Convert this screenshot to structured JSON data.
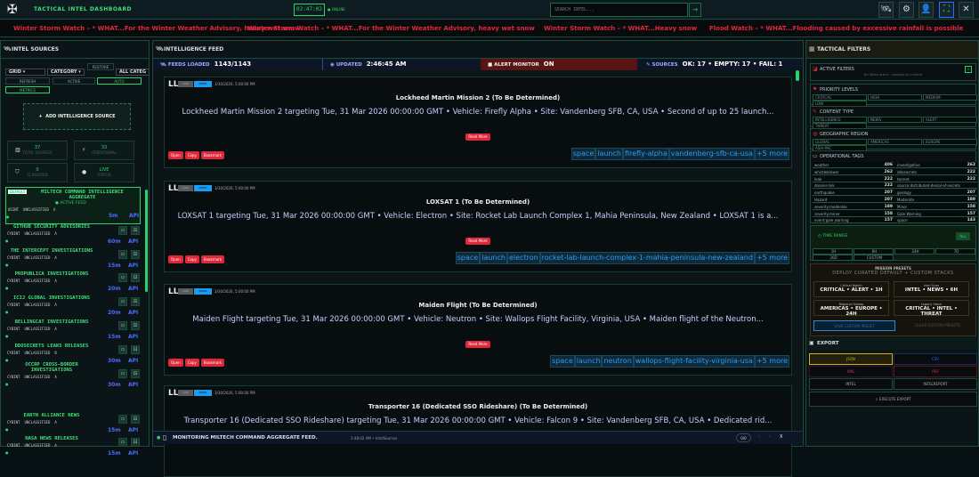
{
  "header": {
    "title": "TACTICAL INTEL DASHBOARD",
    "clock": "02:47:02",
    "status": "ONLINE",
    "search_placeholder": "SEARCH INTEL...",
    "search_go": "→",
    "icons": [
      "satellite-icon",
      "gear-icon",
      "user-icon",
      "fullscreen-icon",
      "close-icon"
    ]
  },
  "ticker": [
    "Winter Storm Watch – * WHAT...For the Winter Weather Advisory, heavy wet snow",
    "Winter Storm Watch – * WHAT...For the Winter Weather Advisory, heavy wet snow",
    "Winter Storm Watch – * WHAT...Heavy snow",
    "Flood Watch – * WHAT...Flooding caused by excessive rainfall is possible"
  ],
  "left": {
    "title": "INTEL SOURCES",
    "view": "GRID",
    "sort": "CATEGORY",
    "filter": "ALL CATEG",
    "restore": "RESTORE",
    "refresh": "REFRESH",
    "active": "ACTIVE",
    "auto": "AUTO",
    "metrics": "METRICS",
    "add": "ADD INTELLIGENCE SOURCE",
    "stats": [
      {
        "v": "37",
        "l": "TOTAL SOURCES",
        "i": "▥"
      },
      {
        "v": "33",
        "l": "OPERATIONAL",
        "i": "⚡"
      },
      {
        "v": "0",
        "l": "CLASSIFIED",
        "i": "⛉"
      },
      {
        "v": "LIVE",
        "l": "STATUS",
        "i": "●"
      }
    ],
    "default_badge": "DEFAULT",
    "active_feed": "● ACTIVE FEED",
    "sources": [
      {
        "name": "MILTECH COMMAND INTELLIGENCE AGGREGATE",
        "type": "OSINT",
        "cls": "UNCLASSIFIED",
        "grade": "A",
        "interval": "5m",
        "api": "API"
      },
      {
        "name": "GITHUB SECURITY ADVISORIES",
        "type": "CYBINT",
        "cls": "UNCLASSIFIED",
        "grade": "A",
        "interval": "60m",
        "api": "API"
      },
      {
        "name": "THE INTERCEPT INVESTIGATIONS",
        "type": "CYBINT",
        "cls": "UNCLASSIFIED",
        "grade": "A",
        "interval": "15m",
        "api": "API"
      },
      {
        "name": "PROPUBLICA INVESTIGATIONS",
        "type": "CYBINT",
        "cls": "UNCLASSIFIED",
        "grade": "A",
        "interval": "20m",
        "api": "API"
      },
      {
        "name": "ICIJ GLOBAL INVESTIGATIONS",
        "type": "CYBINT",
        "cls": "UNCLASSIFIED",
        "grade": "A",
        "interval": "20m",
        "api": "API"
      },
      {
        "name": "BELLINGCAT INVESTIGATIONS",
        "type": "CYBINT",
        "cls": "UNCLASSIFIED",
        "grade": "A",
        "interval": "15m",
        "api": "API"
      },
      {
        "name": "DDOSECRETS LEAKS RELEASES",
        "type": "CYBINT",
        "cls": "UNCLASSIFIED",
        "grade": "B",
        "interval": "30m",
        "api": "API"
      },
      {
        "name": "OCCRP CROSS-BORDER INVESTIGATIONS",
        "type": "CYBINT",
        "cls": "UNCLASSIFIED",
        "grade": "A",
        "interval": "30m",
        "api": "API"
      },
      {
        "name": "EARTH ALLIANCE NEWS",
        "type": "CYBINT",
        "cls": "UNCLASSIFIED",
        "grade": "A",
        "interval": "15m",
        "api": "API"
      },
      {
        "name": "NASA NEWS RELEASES",
        "type": "CYBINT",
        "cls": "UNCLASSIFIED",
        "grade": "A",
        "interval": "15m",
        "api": "API"
      }
    ]
  },
  "feed": {
    "title": "INTELLIGENCE FEED",
    "loaded_label": "FEEDS LOADED",
    "loaded": "1143/1143",
    "updated_label": "UPDATED",
    "updated": "2:46:45 AM",
    "alert_label": "ALERT MONITOR",
    "alert": "ON",
    "sources_label": "SOURCES",
    "sources": "OK: 17 • EMPTY: 17 • FAIL: 1",
    "source_abbr": "LL",
    "badge1": "LOW",
    "badge2": "NEWS",
    "read_more": "Read More",
    "actions": [
      "Open",
      "Copy",
      "Bookmark"
    ],
    "items": [
      {
        "date": "3/30/2026, 5:00:00 PM",
        "title": "Lockheed Martin Mission 2 (To Be Determined)",
        "summary": "Lockheed Martin Mission 2 targeting Tue, 31 Mar 2026 00:00:00 GMT • Vehicle: Firefly Alpha • Site: Vandenberg SFB, CA, USA • Second of up to 25 launch...",
        "tags": [
          "space",
          "launch",
          "firefly-alpha",
          "vandenberg-sfb-ca-usa",
          "+5 more"
        ]
      },
      {
        "date": "3/30/2026, 5:00:00 PM",
        "title": "LOXSAT 1 (To Be Determined)",
        "summary": "LOXSAT 1 targeting Tue, 31 Mar 2026 00:00:00 GMT • Vehicle: Electron • Site: Rocket Lab Launch Complex 1, Mahia Peninsula, New Zealand • LOXSAT 1 is a...",
        "tags": [
          "space",
          "launch",
          "electron",
          "rocket-lab-launch-complex-1-mahia-peninsula-new-zealand",
          "+5 more"
        ]
      },
      {
        "date": "3/30/2026, 5:00:00 PM",
        "title": "Maiden Flight (To Be Determined)",
        "summary": "Maiden Flight targeting Tue, 31 Mar 2026 00:00:00 GMT • Vehicle: Neutron • Site: Wallops Flight Facility, Virginia, USA • Maiden flight of the Neutron...",
        "tags": [
          "space",
          "launch",
          "neutron",
          "wallops-flight-facility-virginia-usa",
          "+5 more"
        ]
      },
      {
        "date": "3/30/2026, 5:00:00 PM",
        "title": "Transporter 16 (Dedicated SSO Rideshare) (To Be Determined)",
        "summary": "Transporter 16 (Dedicated SSO Rideshare) targeting Tue, 31 Mar 2026 00:00:00 GMT • Vehicle: Falcon 9 • Site: Vandenberg SFB, CA, USA • Dedicated rid...",
        "tags": []
      }
    ],
    "bottom": {
      "message": "MONITORING MILTECH COMMAND AGGREGATE FEED.",
      "meta": "2:48:02 AM • IntelSources",
      "counter": "0/0",
      "close": "X"
    }
  },
  "right": {
    "title": "TACTICAL FILTERS",
    "active_filters": "ACTIVE FILTERS",
    "no_filters": "No filters active - showing all content",
    "priority": "PRIORITY LEVELS",
    "priority_opts": [
      "CRITICAL",
      "HIGH",
      "MEDIUM",
      "LOW"
    ],
    "content": "CONTENT TYPE",
    "content_opts": [
      "INTELLIGENCE",
      "NEWS",
      "ALERT",
      "THREAT"
    ],
    "region": "GEOGRAPHIC REGION",
    "region_opts": [
      "GLOBAL",
      "AMERICAS",
      "EUROPE",
      "ASIA-PAC"
    ],
    "tags_title": "OPERATIONAL TAGS",
    "tags": [
      {
        "t": "weather",
        "c": "406"
      },
      {
        "t": "investigative",
        "c": "262"
      },
      {
        "t": "whistleblower",
        "c": "262"
      },
      {
        "t": "ddosecrets",
        "c": "222"
      },
      {
        "t": "leak",
        "c": "222"
      },
      {
        "t": "torrent",
        "c": "222"
      },
      {
        "t": "dossier-link",
        "c": "222"
      },
      {
        "t": "source:distributed-denial-of-secrets",
        "c": ""
      },
      {
        "t": "earthquake",
        "c": "207"
      },
      {
        "t": "geology",
        "c": "207"
      },
      {
        "t": "Hazard",
        "c": "207"
      },
      {
        "t": "Moderate",
        "c": "189"
      },
      {
        "t": "severity:moderate",
        "c": "189"
      },
      {
        "t": "Minor",
        "c": "158"
      },
      {
        "t": "severity:minor",
        "c": "158"
      },
      {
        "t": "Gale Warning",
        "c": "157"
      },
      {
        "t": "event:gale warning",
        "c": "157"
      },
      {
        "t": "space",
        "c": "143"
      }
    ],
    "time_range": "TIME RANGE",
    "time_all": "ALL",
    "time_opts": [
      "1H",
      "6H",
      "24H",
      "7D",
      "30D",
      "CUSTOM"
    ],
    "presets_title": "MISSION PRESETS",
    "presets_sub": "DEPLOY CURATED DEFAULT + CUSTOM STACKS",
    "presets": [
      {
        "a": "Critical Watch",
        "b": "CRITICAL • ALERT • 1H"
      },
      {
        "a": "Intel Scan",
        "b": "INTEL • NEWS • 6H"
      },
      {
        "a": "Regional Sweep",
        "b": "AMERICAS • EUROPE • 24H"
      },
      {
        "a": "Legacy Stack",
        "b": "CRITICAL • INTEL • THREAT"
      }
    ],
    "save_preset": "SAVE CUSTOM PRESET",
    "clear_presets": "CLEAR CUSTOM PRESETS",
    "export": "EXPORT",
    "formats": [
      "JSON",
      "CSV",
      "XML",
      "PDF"
    ],
    "scope": [
      "INTEL",
      "INTELREPORT"
    ],
    "execute": "EXECUTE EXPORT"
  }
}
